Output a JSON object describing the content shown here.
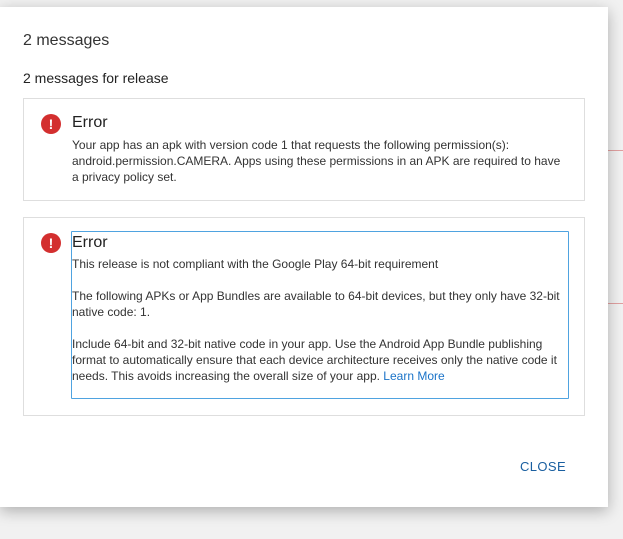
{
  "dialog": {
    "title": "2 messages",
    "section_title": "2 messages for release",
    "close_label": "CLOSE"
  },
  "messages": [
    {
      "icon": "error-icon",
      "title": "Error",
      "body": "Your app has an apk with version code 1 that requests the following permission(s): android.permission.CAMERA. Apps using these permissions in an APK are required to have a privacy policy set."
    },
    {
      "icon": "error-icon",
      "title": "Error",
      "paragraph1": "This release is not compliant with the Google Play 64-bit requirement",
      "paragraph2": "The following APKs or App Bundles are available to 64-bit devices, but they only have 32-bit native code: 1.",
      "paragraph3": "Include 64-bit and 32-bit native code in your app. Use the Android App Bundle publishing format to automatically ensure that each device architecture receives only the native code it needs. This avoids increasing the overall size of your app.",
      "link_label": "Learn More"
    }
  ],
  "colors": {
    "error": "#d32f2f",
    "link": "#1a73c8",
    "close": "#1a5fa0",
    "selection": "#4fa3e0"
  }
}
